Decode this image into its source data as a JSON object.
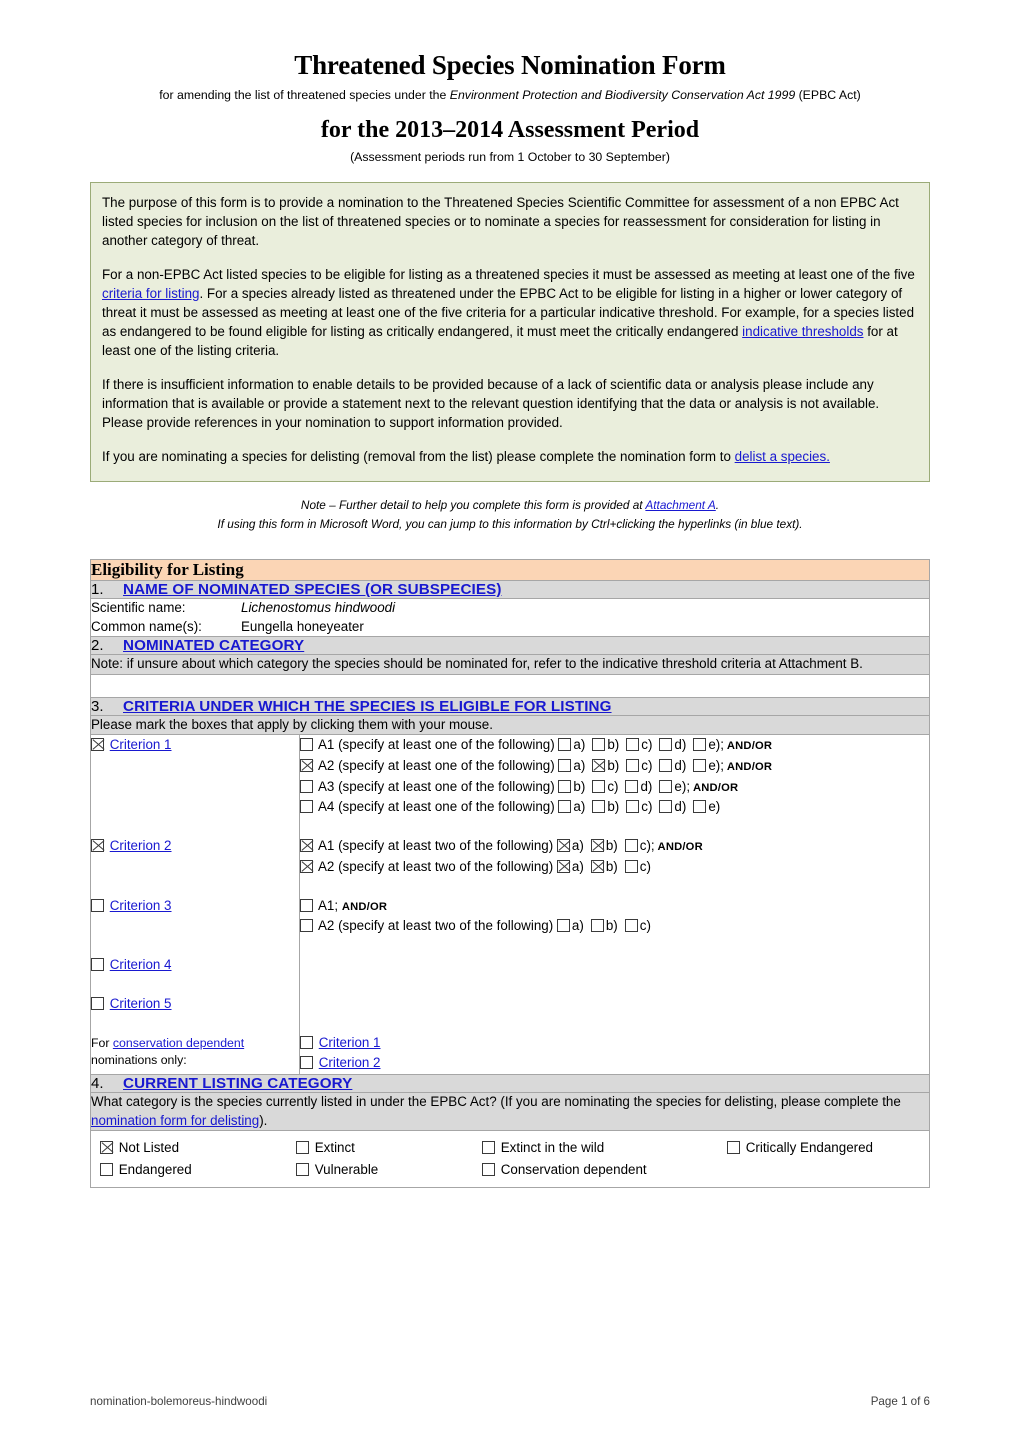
{
  "document": {
    "title_line1": "Threatened Species Nomination Form",
    "subtitle_line1_pre": "for amending the list of threatened species under the ",
    "subtitle_line1_italic": "Environment Protection and Biodiversity Conservation Act 1999",
    "subtitle_line1_post": " (EPBC Act)",
    "title_line2": "for the 2013–2014 Assessment Period",
    "subtitle_line2": "(Assessment periods run from 1 October to 30 September)"
  },
  "purpose": {
    "p1": "The purpose of this form is to provide a nomination to the Threatened Species Scientific Committee for assessment of a non EPBC Act listed species for inclusion on the list of threatened species or to nominate a species for reassessment for consideration for listing in another category of threat.",
    "p2_part1": "For a non-EPBC Act listed species to be eligible for listing as a threatened species it must be assessed as meeting at least one of the five ",
    "p2_link1": "criteria for listing",
    "p2_part2": ". For a species already listed as threatened under the EPBC Act to be eligible for listing in a higher or lower category of threat it must be assessed as meeting at least one of the five criteria for a particular indicative threshold. For example, for a species listed as endangered to be found eligible for listing as critically endangered, it must meet the critically endangered ",
    "p2_link2": "indicative thresholds",
    "p2_part3": " for at least one of the listing criteria.",
    "p3": "If there is insufficient information to enable details to be provided because of a lack of scientific data or analysis please include any information that is available or provide a statement next to the relevant question identifying that the data or analysis is not available. Please provide references in your nomination to support information provided.",
    "p4_part1": "If you are nominating a species for delisting (removal from the list) please complete the nomination form to ",
    "p4_link": "delist a species."
  },
  "note": {
    "line1_pre": "Note – Further detail to help you complete this form is provided at ",
    "line1_link": "Attachment A",
    "line1_post": ".",
    "line2": "If using this form in Microsoft Word, you can jump to this information by Ctrl+clicking the hyperlinks (in blue text)."
  },
  "eligibility_band": {
    "title": "Eligibility for Listing"
  },
  "section1": {
    "number": "1.",
    "heading": "NAME OF NOMINATED SPECIES (OR SUBSPECIES)",
    "scientific_label": "Scientific name:",
    "scientific_value": "Lichenostomus hindwoodi",
    "common_label": "Common name(s):",
    "common_value": "Eungella honeyeater"
  },
  "section2": {
    "number": "2.",
    "heading": "NOMINATED CATEGORY",
    "note": "Note: if unsure about which category the species should be nominated for, refer to the indicative threshold criteria at Attachment B."
  },
  "section3": {
    "number": "3.",
    "heading": "CRITERIA UNDER WHICH THE SPECIES IS ELIGIBLE FOR LISTING",
    "instruction": "Please mark the boxes that apply by clicking them with your mouse.",
    "criteria": [
      {
        "label": "Criterion 1",
        "checked": true,
        "rows": [
          {
            "main_checked": false,
            "text": "A1 (specify at least one of the following)",
            "options": [
              {
                "letter": "a)",
                "checked": false
              },
              {
                "letter": "b)",
                "checked": false
              },
              {
                "letter": "c)",
                "checked": false
              },
              {
                "letter": "d)",
                "checked": false
              },
              {
                "letter": "e)",
                "checked": false
              }
            ],
            "suffix": ";",
            "andor": "AND/OR"
          },
          {
            "main_checked": true,
            "text": "A2 (specify at least one of the following)",
            "options": [
              {
                "letter": "a)",
                "checked": false
              },
              {
                "letter": "b)",
                "checked": true
              },
              {
                "letter": "c)",
                "checked": false
              },
              {
                "letter": "d)",
                "checked": false
              },
              {
                "letter": "e)",
                "checked": false
              }
            ],
            "suffix": ";",
            "andor": "AND/OR"
          },
          {
            "main_checked": false,
            "text": "A3 (specify at least one of the following)",
            "options": [
              {
                "letter": "b)",
                "checked": false
              },
              {
                "letter": "c)",
                "checked": false
              },
              {
                "letter": "d)",
                "checked": false
              },
              {
                "letter": "e)",
                "checked": false
              }
            ],
            "suffix": ";",
            "andor": "AND/OR"
          },
          {
            "main_checked": false,
            "text": "A4 (specify at least one of the following)",
            "options": [
              {
                "letter": "a)",
                "checked": false
              },
              {
                "letter": "b)",
                "checked": false
              },
              {
                "letter": "c)",
                "checked": false
              },
              {
                "letter": "d)",
                "checked": false
              },
              {
                "letter": "e)",
                "checked": false
              }
            ],
            "suffix": "",
            "andor": ""
          }
        ]
      },
      {
        "label": "Criterion 2",
        "checked": true,
        "rows": [
          {
            "main_checked": true,
            "text": "A1 (specify at least two of the following)",
            "options": [
              {
                "letter": "a)",
                "checked": true
              },
              {
                "letter": "b)",
                "checked": true
              },
              {
                "letter": "c)",
                "checked": false
              }
            ],
            "suffix": ";",
            "andor": "AND/OR"
          },
          {
            "main_checked": true,
            "text": "A2 (specify at least two of the following)",
            "options": [
              {
                "letter": "a)",
                "checked": true
              },
              {
                "letter": "b)",
                "checked": true
              },
              {
                "letter": "c)",
                "checked": false
              }
            ],
            "suffix": "",
            "andor": ""
          }
        ]
      },
      {
        "label": "Criterion 3",
        "checked": false,
        "rows": [
          {
            "main_checked": false,
            "text": "A1;",
            "options": [],
            "suffix": "",
            "andor": "AND/OR"
          },
          {
            "main_checked": false,
            "text": "A2 (specify at least two of the following)",
            "options": [
              {
                "letter": "a)",
                "checked": false
              },
              {
                "letter": "b)",
                "checked": false
              },
              {
                "letter": "c)",
                "checked": false
              }
            ],
            "suffix": "",
            "andor": ""
          }
        ]
      },
      {
        "label": "Criterion 4",
        "checked": false,
        "rows": []
      },
      {
        "label": "Criterion 5",
        "checked": false,
        "rows": []
      }
    ],
    "conservation_dependent": {
      "prefix": "For ",
      "link": "conservation dependent",
      "suffix": "nominations only:",
      "options": [
        {
          "label": "Criterion 1",
          "checked": false
        },
        {
          "label": "Criterion 2",
          "checked": false
        }
      ]
    }
  },
  "section4": {
    "number": "4.",
    "heading": "CURRENT LISTING CATEGORY",
    "question_part1": "What category is the species currently listed in under the EPBC Act? (If you are nominating the species for delisting, please complete the ",
    "question_link": "nomination form for delisting",
    "question_part2": ").",
    "categories": [
      {
        "label": "Not Listed",
        "checked": true
      },
      {
        "label": "Endangered",
        "checked": false
      },
      {
        "label": "Extinct",
        "checked": false
      },
      {
        "label": "Vulnerable",
        "checked": false
      },
      {
        "label": "Extinct in the wild",
        "checked": false
      },
      {
        "label": "Conservation dependent",
        "checked": false
      },
      {
        "label": "Critically Endangered",
        "checked": false
      }
    ]
  },
  "footer": {
    "left": "nomination-bolemoreus-hindwoodi",
    "right": "Page 1 of 6"
  }
}
